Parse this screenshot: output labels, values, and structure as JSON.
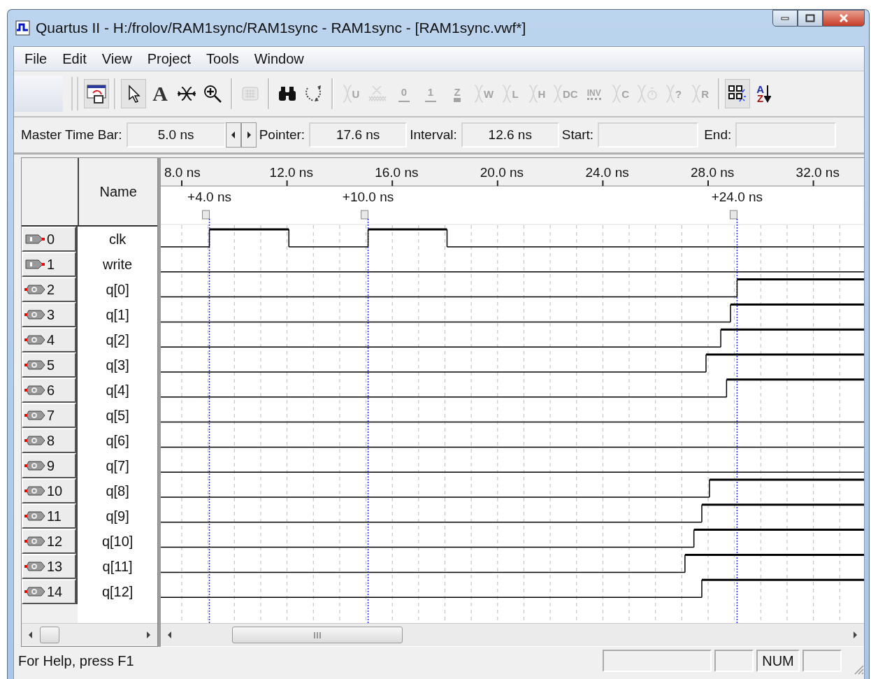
{
  "window": {
    "title": "Quartus II - H:/frolov/RAM1sync/RAM1sync - RAM1sync - [RAM1sync.vwf*]"
  },
  "menu": [
    "File",
    "Edit",
    "View",
    "Project",
    "Tools",
    "Window"
  ],
  "toolbar": [
    [
      {
        "kind": "insert",
        "selected": true,
        "disabled": false
      }
    ],
    [
      {
        "kind": "pointer",
        "selected": true,
        "disabled": false
      },
      {
        "kind": "text",
        "glyph": "A",
        "selected": false,
        "disabled": false
      },
      {
        "kind": "waveedit",
        "selected": false,
        "disabled": false
      },
      {
        "kind": "zoom",
        "selected": false,
        "disabled": false
      }
    ],
    [
      {
        "kind": "grid",
        "selected": false,
        "disabled": true
      }
    ],
    [
      {
        "kind": "find",
        "selected": false,
        "disabled": false
      },
      {
        "kind": "replace",
        "selected": false,
        "disabled": false
      }
    ],
    [
      {
        "kind": "value",
        "glyph": "U",
        "selected": false,
        "disabled": true
      },
      {
        "kind": "weak",
        "selected": false,
        "disabled": true
      },
      {
        "kind": "low",
        "glyph": "0",
        "selected": false,
        "disabled": true
      },
      {
        "kind": "high",
        "glyph": "1",
        "selected": false,
        "disabled": true
      },
      {
        "kind": "highz",
        "glyph": "Z",
        "selected": false,
        "disabled": true
      },
      {
        "kind": "value",
        "glyph": "W",
        "selected": false,
        "disabled": true
      },
      {
        "kind": "value",
        "glyph": "L",
        "selected": false,
        "disabled": true
      },
      {
        "kind": "value",
        "glyph": "H",
        "selected": false,
        "disabled": true
      },
      {
        "kind": "value",
        "glyph": "DC",
        "selected": false,
        "disabled": true
      },
      {
        "kind": "invert",
        "glyph": "INV",
        "selected": false,
        "disabled": true
      },
      {
        "kind": "value",
        "glyph": "C",
        "selected": false,
        "disabled": true
      },
      {
        "kind": "count",
        "selected": false,
        "disabled": true
      },
      {
        "kind": "value",
        "glyph": "?",
        "selected": false,
        "disabled": true
      },
      {
        "kind": "value",
        "glyph": "R",
        "selected": false,
        "disabled": true
      }
    ],
    [
      {
        "kind": "snap",
        "selected": true,
        "disabled": false
      },
      {
        "kind": "sort",
        "glyph": "A",
        "glyph2": "Z",
        "selected": false,
        "disabled": false
      }
    ]
  ],
  "time_bar": {
    "master": {
      "label": "Master Time Bar:",
      "value": "5.0 ns"
    },
    "fields": [
      {
        "label": "Pointer:",
        "value": "17.6 ns"
      },
      {
        "label": "Interval:",
        "value": "12.6 ns"
      },
      {
        "label": "Start:"
      },
      {
        "label": "End:"
      }
    ]
  },
  "signals_header": {
    "name": "Name"
  },
  "ruler": [
    "8.0 ns",
    "12.0 ns",
    "16.0 ns",
    "20.0 ns",
    "24.0 ns",
    "28.0 ns",
    "32.0 ns"
  ],
  "cursors": [
    {
      "label": "+4.0 ns"
    },
    {
      "label": "+10.0 ns"
    },
    {
      "label": "+24.0 ns"
    }
  ],
  "signals": [
    {
      "index": "0",
      "kind": "input",
      "name": "clk"
    },
    {
      "index": "1",
      "kind": "input",
      "name": "write"
    },
    {
      "index": "2",
      "kind": "output",
      "name": "q[0]"
    },
    {
      "index": "3",
      "kind": "output",
      "name": "q[1]"
    },
    {
      "index": "4",
      "kind": "output",
      "name": "q[2]"
    },
    {
      "index": "5",
      "kind": "output",
      "name": "q[3]"
    },
    {
      "index": "6",
      "kind": "output",
      "name": "q[4]"
    },
    {
      "index": "7",
      "kind": "output",
      "name": "q[5]"
    },
    {
      "index": "8",
      "kind": "output",
      "name": "q[6]"
    },
    {
      "index": "9",
      "kind": "output",
      "name": "q[7]"
    },
    {
      "index": "10",
      "kind": "output",
      "name": "q[8]"
    },
    {
      "index": "11",
      "kind": "output",
      "name": "q[9]"
    },
    {
      "index": "12",
      "kind": "output",
      "name": "q[10]"
    },
    {
      "index": "13",
      "kind": "output",
      "name": "q[11]"
    },
    {
      "index": "14",
      "kind": "output",
      "name": "q[12]"
    }
  ],
  "status_bar": {
    "text": "For Help, press F1",
    "indicators": [
      "NUM"
    ]
  }
}
